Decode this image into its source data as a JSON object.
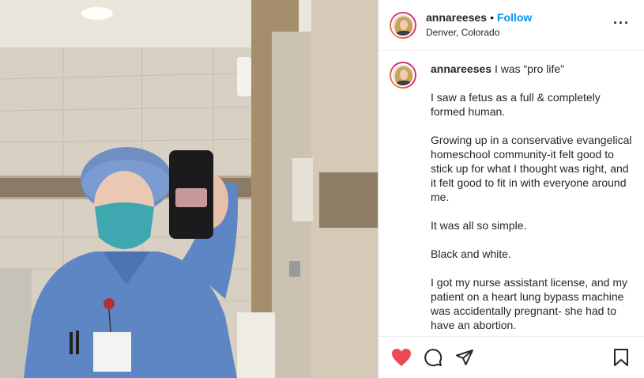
{
  "post": {
    "username": "annareeses",
    "separator": "•",
    "follow_label": "Follow",
    "location": "Denver, Colorado",
    "more_label": "•••"
  },
  "caption": {
    "username": "annareeses",
    "first_line": "I was “pro life”",
    "paragraphs": [
      "I saw a fetus as a full & completely formed human.",
      "Growing up in a conservative evangelical homeschool community-it felt good to stick up for what I thought was right, and it felt good to fit in with everyone around me.",
      "It was all so simple.",
      "Black and white.",
      "I got my nurse assistant license, and my patient on a heart lung bypass machine was accidentally pregnant- she had to have an abortion."
    ]
  },
  "actions": {
    "like_icon": "heart-filled-icon",
    "comment_icon": "comment-icon",
    "share_icon": "send-icon",
    "save_icon": "bookmark-icon",
    "like_color": "#ed4956"
  },
  "colors": {
    "accent": "#0095f6",
    "text": "#262626"
  }
}
